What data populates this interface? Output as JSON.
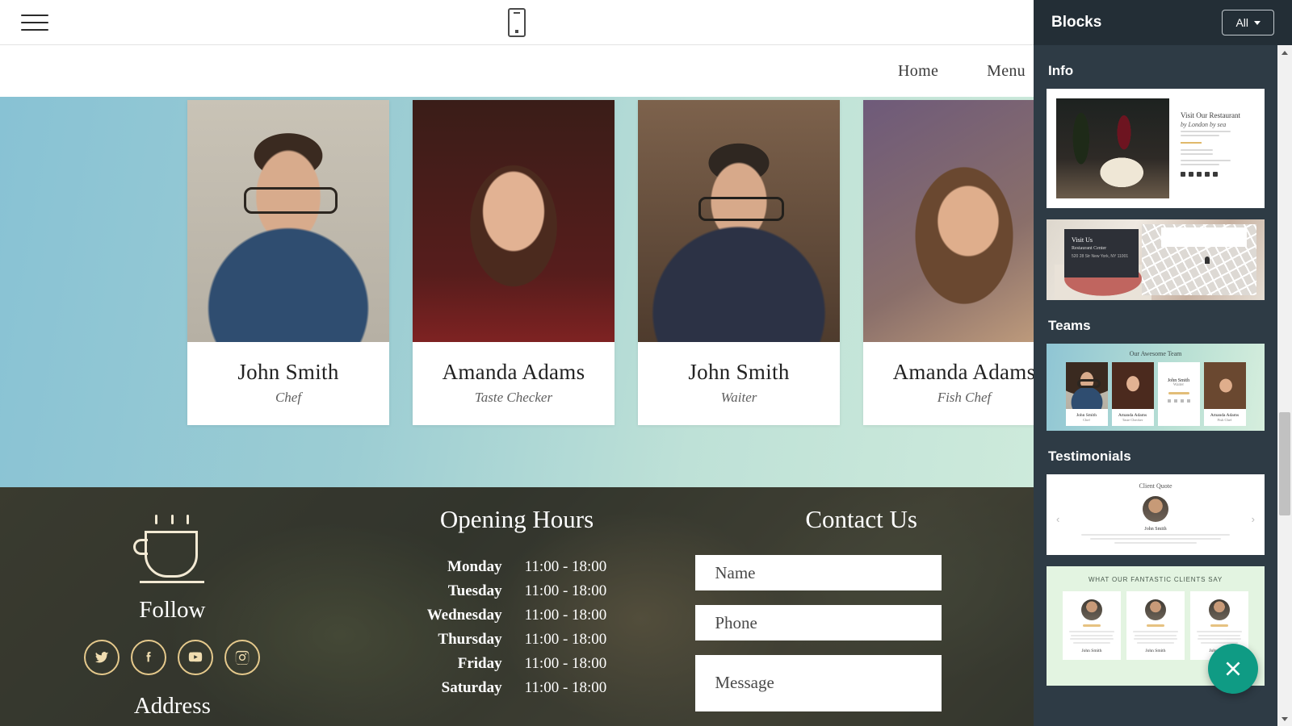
{
  "editor": {
    "menu_icon": "hamburger-menu-icon",
    "device_preview_icon": "mobile-device-icon"
  },
  "site": {
    "nav": [
      {
        "label": "Home"
      },
      {
        "label": "Menu"
      }
    ],
    "team": {
      "members": [
        {
          "name": "John Smith",
          "role": "Chef"
        },
        {
          "name": "Amanda Adams",
          "role": "Taste Checker"
        },
        {
          "name": "John Smith",
          "role": "Waiter"
        },
        {
          "name": "Amanda Adams",
          "role": "Fish Chef"
        }
      ]
    },
    "footer": {
      "logo_icon": "coffee-cup-icon",
      "follow_title": "Follow",
      "address_title": "Address",
      "social": [
        {
          "name": "twitter-icon"
        },
        {
          "name": "facebook-icon"
        },
        {
          "name": "youtube-icon"
        },
        {
          "name": "instagram-icon"
        }
      ],
      "hours_title": "Opening Hours",
      "hours": [
        {
          "day": "Monday",
          "time": "11:00 - 18:00"
        },
        {
          "day": "Tuesday",
          "time": "11:00 - 18:00"
        },
        {
          "day": "Wednesday",
          "time": "11:00 - 18:00"
        },
        {
          "day": "Thursday",
          "time": "11:00 - 18:00"
        },
        {
          "day": "Friday",
          "time": "11:00 - 18:00"
        },
        {
          "day": "Saturday",
          "time": "11:00 - 18:00"
        }
      ],
      "contact_title": "Contact Us",
      "fields": [
        {
          "placeholder": "Name"
        },
        {
          "placeholder": "Phone"
        },
        {
          "placeholder": "Message"
        }
      ]
    }
  },
  "panel": {
    "title": "Blocks",
    "filter": {
      "label": "All",
      "icon": "chevron-down-icon"
    },
    "groups": [
      {
        "title": "Info",
        "blocks": [
          {
            "kind": "info-card",
            "heading": "Visit Our Restaurant",
            "subheading": "by London by sea"
          },
          {
            "kind": "map-card",
            "heading": "Visit Us",
            "subheading": "Restaurant Center",
            "address": "520 28 Str\nNew York, NY 11001"
          }
        ]
      },
      {
        "title": "Teams",
        "blocks": [
          {
            "kind": "team-card",
            "heading": "Our Awesome Team",
            "members": [
              {
                "name": "John Smith",
                "role": "Chef"
              },
              {
                "name": "Amanda Adams",
                "role": "Taste Checker"
              },
              {
                "name": "John Smith",
                "role": "Waiter"
              },
              {
                "name": "Amanda Adams",
                "role": "Fish Chef"
              }
            ]
          }
        ]
      },
      {
        "title": "Testimonials",
        "blocks": [
          {
            "kind": "quote-carousel",
            "heading": "Client Quote",
            "name": "John Smith",
            "prev_icon": "chevron-left-icon",
            "next_icon": "chevron-right-icon"
          },
          {
            "kind": "clients-card",
            "heading": "WHAT OUR FANTASTIC CLIENTS SAY",
            "cards": [
              {
                "name": "John Smith"
              },
              {
                "name": "John Smith"
              },
              {
                "name": "John Smith"
              }
            ]
          }
        ]
      }
    ],
    "scrollbar": {
      "up_icon": "scroll-up-arrow-icon",
      "down_icon": "scroll-down-arrow-icon"
    }
  },
  "fab": {
    "icon": "close-icon"
  },
  "colors": {
    "panel_bg": "#2e3b45",
    "panel_head_bg": "#232e36",
    "accent_teal": "#0f9b84",
    "gradient_start": "#88c2d4",
    "gradient_end": "#cdeadb",
    "gold": "#e5c98c"
  }
}
